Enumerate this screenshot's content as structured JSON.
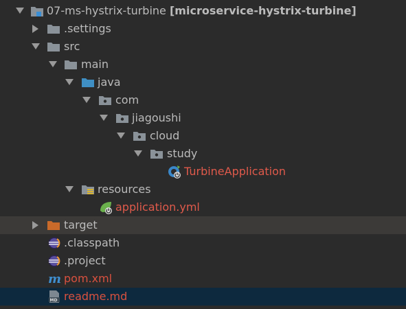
{
  "tree": {
    "root": {
      "label": "07-ms-hystrix-turbine",
      "module": "[microservice-hystrix-turbine]",
      "icon": "module-folder-icon",
      "state": "expanded"
    },
    "settings": {
      "label": ".settings",
      "icon": "folder-icon",
      "state": "collapsed"
    },
    "src": {
      "label": "src",
      "icon": "folder-icon",
      "state": "expanded"
    },
    "main": {
      "label": "main",
      "icon": "folder-icon",
      "state": "expanded"
    },
    "java": {
      "label": "java",
      "icon": "source-root-folder-icon",
      "state": "expanded"
    },
    "com": {
      "label": "com",
      "icon": "package-icon",
      "state": "expanded"
    },
    "jiagoushi": {
      "label": "jiagoushi",
      "icon": "package-icon",
      "state": "expanded"
    },
    "cloud": {
      "label": "cloud",
      "icon": "package-icon",
      "state": "expanded"
    },
    "study": {
      "label": "study",
      "icon": "package-icon",
      "state": "expanded"
    },
    "turbine_app": {
      "label": "TurbineApplication",
      "icon": "spring-boot-class-icon"
    },
    "resources": {
      "label": "resources",
      "icon": "resources-folder-icon",
      "state": "expanded"
    },
    "application_yml": {
      "label": "application.yml",
      "icon": "spring-yml-icon"
    },
    "target": {
      "label": "target",
      "icon": "excluded-folder-icon",
      "state": "collapsed"
    },
    "classpath": {
      "label": ".classpath",
      "icon": "eclipse-file-icon"
    },
    "project": {
      "label": ".project",
      "icon": "eclipse-file-icon"
    },
    "pom": {
      "label": "pom.xml",
      "icon": "maven-icon"
    },
    "readme": {
      "label": "readme.md",
      "icon": "markdown-icon"
    }
  },
  "colors": {
    "background": "#2b2b2b",
    "text": "#bbbbbb",
    "modified_red": "#e05a4b",
    "target_row": "#3c3a38",
    "selected_row": "#0d293e"
  }
}
